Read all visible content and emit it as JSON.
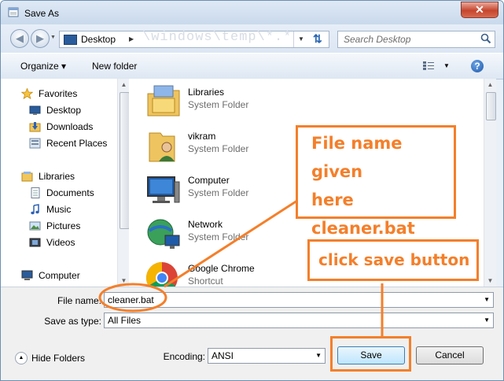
{
  "window": {
    "title": "Save As",
    "close_glyph": "✕"
  },
  "address": {
    "location": "Desktop",
    "watermark": "\\windows\\temp\\*.*"
  },
  "search": {
    "placeholder": "Search Desktop"
  },
  "toolbar": {
    "organize_label": "Organize ▾",
    "new_folder_label": "New folder"
  },
  "nav": {
    "items": [
      {
        "label": "Favorites",
        "icon": "star-icon"
      },
      {
        "label": "Desktop",
        "icon": "desktop-icon"
      },
      {
        "label": "Downloads",
        "icon": "downloads-icon"
      },
      {
        "label": "Recent Places",
        "icon": "recent-places-icon"
      },
      {
        "label": "Libraries",
        "icon": "libraries-icon"
      },
      {
        "label": "Documents",
        "icon": "documents-icon"
      },
      {
        "label": "Music",
        "icon": "music-icon"
      },
      {
        "label": "Pictures",
        "icon": "pictures-icon"
      },
      {
        "label": "Videos",
        "icon": "videos-icon"
      },
      {
        "label": "Computer",
        "icon": "computer-icon"
      }
    ]
  },
  "files": [
    {
      "name": "Libraries",
      "type": "System Folder",
      "icon": "libraries-folder-icon"
    },
    {
      "name": "vikram",
      "type": "System Folder",
      "icon": "user-folder-icon"
    },
    {
      "name": "Computer",
      "type": "System Folder",
      "icon": "computer-icon"
    },
    {
      "name": "Network",
      "type": "System Folder",
      "icon": "network-icon"
    },
    {
      "name": "Google Chrome",
      "type": "Shortcut",
      "icon": "chrome-icon"
    }
  ],
  "form": {
    "file_name_label": "File name:",
    "file_name_value": "cleaner.bat",
    "save_as_type_label": "Save as type:",
    "save_as_type_value": "All Files",
    "encoding_label": "Encoding:",
    "encoding_value": "ANSI",
    "hide_folders_label": "Hide Folders",
    "save_label": "Save",
    "cancel_label": "Cancel"
  },
  "annotations": {
    "file_name_note_line1": "File name given",
    "file_name_note_line2": "here",
    "file_name_note_line3": "cleaner.bat",
    "save_note": "click save button"
  },
  "colors": {
    "annotation": "#f47f2a",
    "window_border": "#6d8fb0",
    "accent": "#2a66b3"
  }
}
